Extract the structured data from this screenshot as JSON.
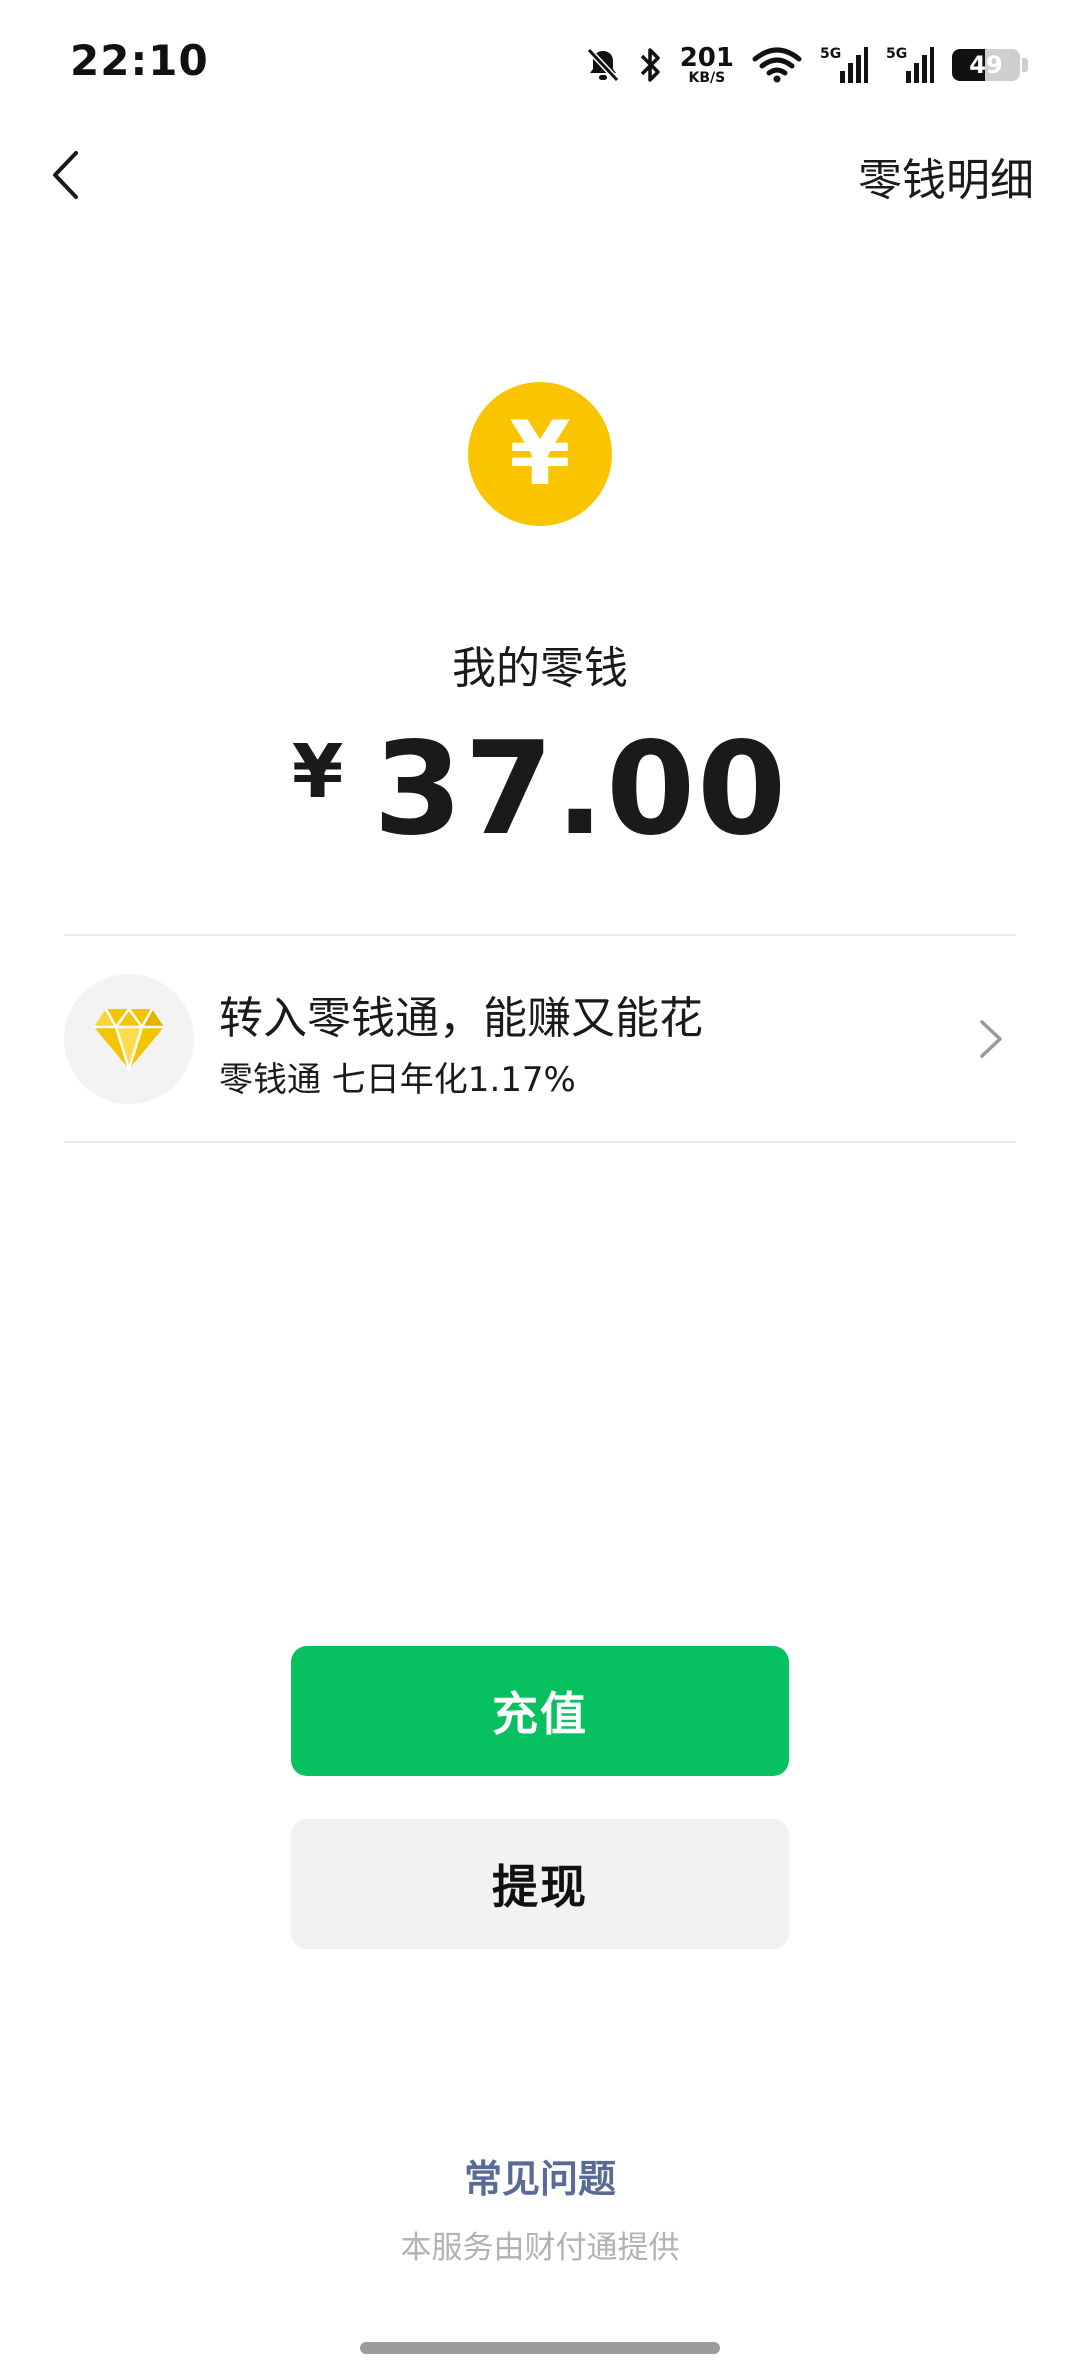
{
  "status_bar": {
    "time": "22:10",
    "network_speed_value": "201",
    "network_speed_unit": "KB/S",
    "signal_1_label": "5G",
    "signal_2_label": "5G",
    "battery_level": "49",
    "icons": [
      "bell-muted-icon",
      "bluetooth-icon",
      "wifi-icon",
      "signal-icon",
      "signal-icon",
      "battery-icon"
    ]
  },
  "nav": {
    "detail_link": "零钱明细",
    "back_icon": "chevron-left-icon"
  },
  "balance": {
    "coin_symbol": "¥",
    "label": "我的零钱",
    "currency": "¥",
    "amount": "37.00"
  },
  "promo": {
    "icon": "diamond-icon",
    "title": "转入零钱通，能赚又能花",
    "subtitle": "零钱通 七日年化1.17%"
  },
  "actions": {
    "recharge": "充值",
    "withdraw": "提现"
  },
  "footer": {
    "faq": "常见问题",
    "provider": "本服务由财付通提供"
  },
  "colors": {
    "accent_green": "#07c160",
    "coin_yellow": "#fbc400",
    "link_blue": "#576b95"
  }
}
